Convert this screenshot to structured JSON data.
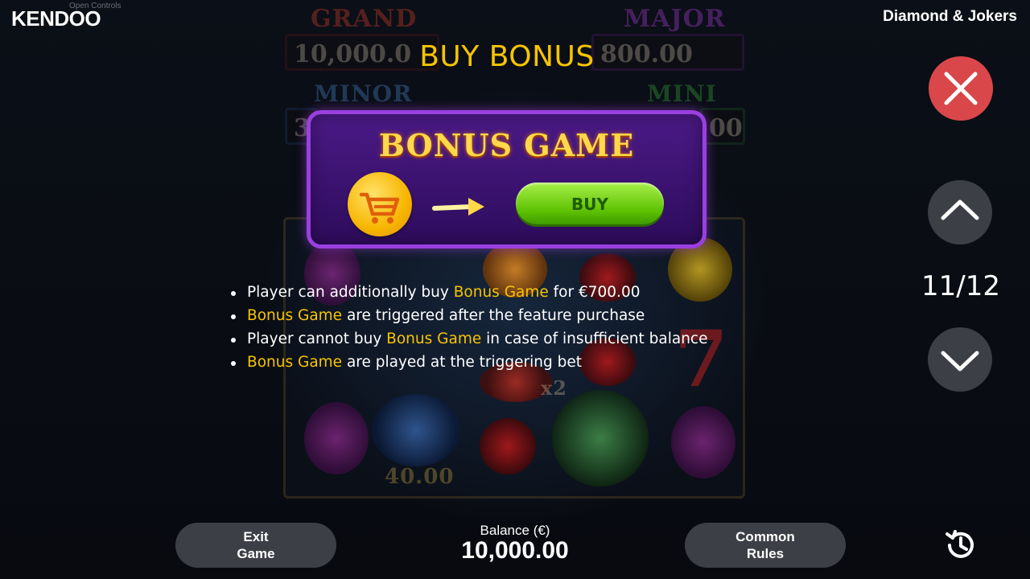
{
  "header": {
    "logo": "KENDOO",
    "open_controls": "Open Controls",
    "game_title": "Diamond & Jokers"
  },
  "background": {
    "jackpots": [
      {
        "label": "GRAND",
        "value": "10,000.0"
      },
      {
        "label": "MAJOR",
        "value": "800.00"
      },
      {
        "label": "MINOR",
        "value": "3"
      },
      {
        "label": "MINI",
        "value": "00"
      }
    ],
    "reel_value": "40.00",
    "multiplier": "x2",
    "seven": "7"
  },
  "page": {
    "heading": "BUY BONUS",
    "indicator": "11/12"
  },
  "bonus_panel": {
    "title": "BONUS GAME",
    "buy_label": "BUY"
  },
  "rules": [
    {
      "pre": "Player can additionally buy ",
      "hl": "Bonus Game",
      "post": " for €700.00"
    },
    {
      "pre": "",
      "hl": "Bonus Game",
      "post": " are triggered after the feature purchase"
    },
    {
      "pre": "Player cannot buy ",
      "hl": "Bonus Game",
      "post": " in case of insufficient balance"
    },
    {
      "pre": "",
      "hl": "Bonus Game",
      "post": " are played at the triggering bet"
    }
  ],
  "footer": {
    "exit_line1": "Exit",
    "exit_line2": "Game",
    "balance_label": "Balance (€)",
    "balance_value": "10,000.00",
    "rules_line1": "Common",
    "rules_line2": "Rules"
  },
  "colors": {
    "highlight": "#f7c400",
    "close": "#d9474a",
    "buy_green": "#5cc000",
    "panel_purple": "#4a1a86"
  },
  "icons": {
    "close": "close-icon",
    "up": "chevron-up-icon",
    "down": "chevron-down-icon",
    "cart": "cart-icon",
    "arrow": "arrow-right-icon",
    "history": "history-icon"
  }
}
